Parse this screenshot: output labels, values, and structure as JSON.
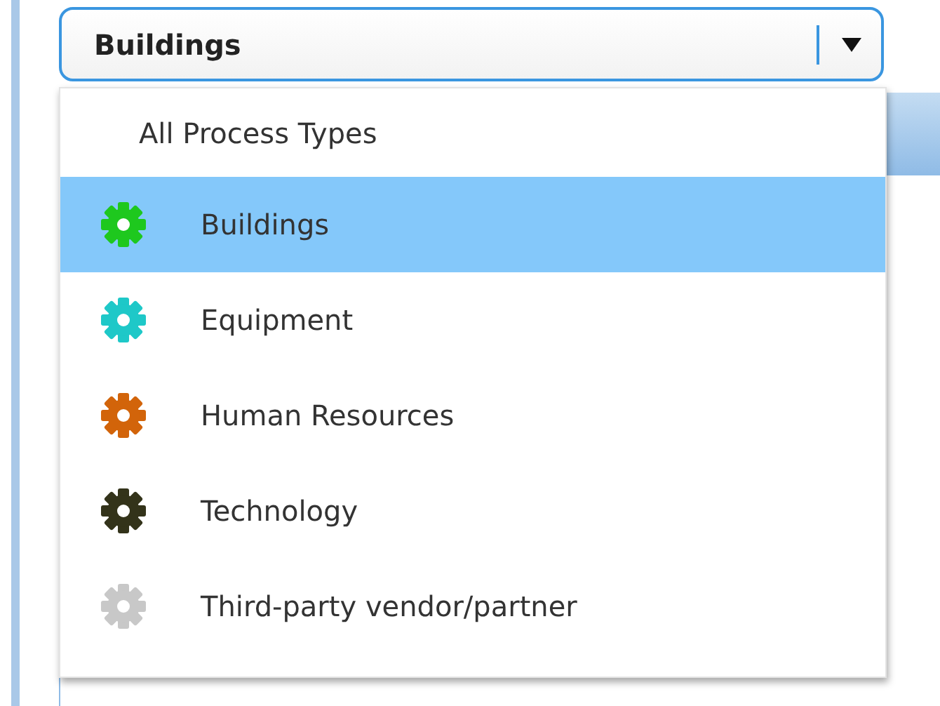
{
  "dropdown": {
    "value": "Buildings",
    "expanded": true,
    "options": [
      {
        "kind": "plain",
        "label": "All Process Types",
        "selected": false
      },
      {
        "kind": "gear",
        "label": "Buildings",
        "selected": true,
        "color": "#1ec81e"
      },
      {
        "kind": "gear",
        "label": "Equipment",
        "selected": false,
        "color": "#1ec8c8"
      },
      {
        "kind": "gear",
        "label": "Human Resources",
        "selected": false,
        "color": "#d2640a"
      },
      {
        "kind": "gear",
        "label": "Technology",
        "selected": false,
        "color": "#33331a"
      },
      {
        "kind": "gear",
        "label": "Third-party vendor/partner",
        "selected": false,
        "color": "#c8c8c8"
      }
    ]
  }
}
